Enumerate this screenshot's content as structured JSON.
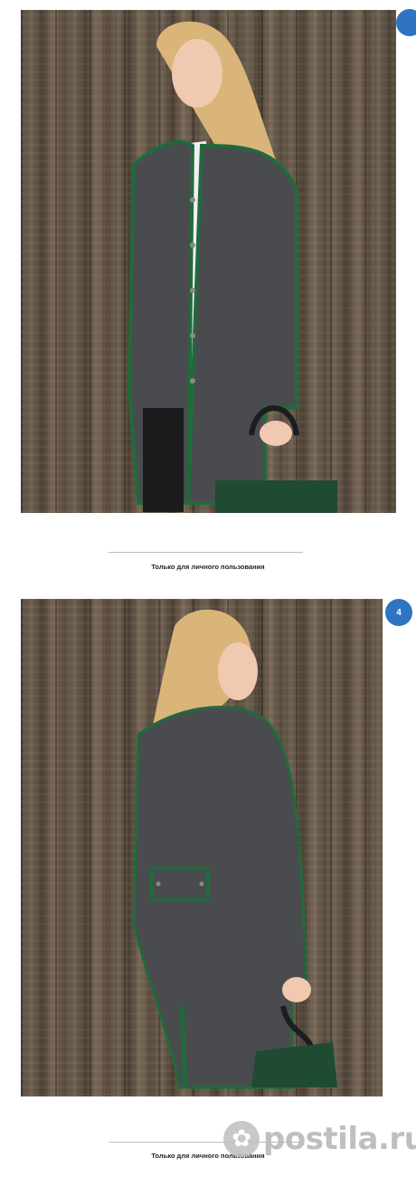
{
  "pages": [
    {
      "caption": "Только для личного пользования"
    },
    {
      "number": "4",
      "caption": "Только для личного пользования"
    }
  ],
  "watermark": {
    "text": "postila.ru",
    "icon": "postila-logo-icon"
  },
  "colors": {
    "badge": "#2f74c0",
    "coat": "#4a4b4f",
    "trim": "#1f6b3b",
    "wood": "#5b4d3f"
  }
}
